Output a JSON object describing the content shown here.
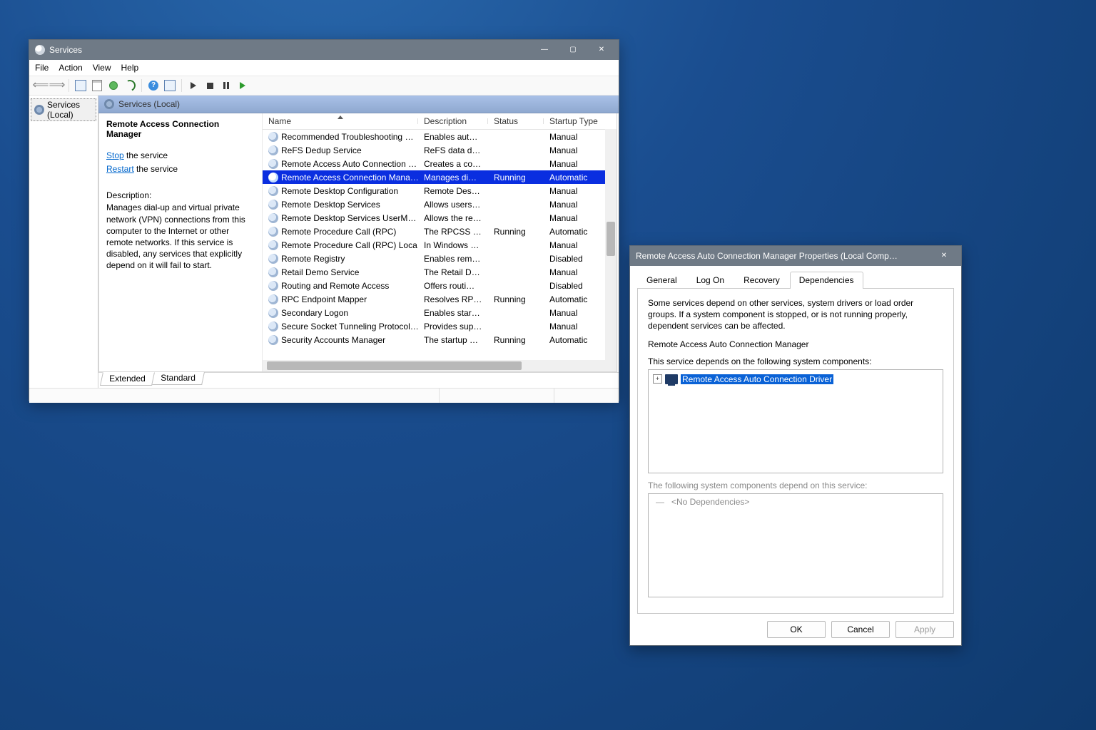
{
  "services_window": {
    "title": "Services",
    "menu": [
      "File",
      "Action",
      "View",
      "Help"
    ],
    "tree_root": "Services (Local)",
    "pane_title": "Services (Local)",
    "selected_name": "Remote Access Connection Manager",
    "action_stop": "Stop",
    "action_stop_suffix": " the service",
    "action_restart": "Restart",
    "action_restart_suffix": " the service",
    "desc_label": "Description:",
    "desc_text": "Manages dial-up and virtual private network (VPN) connections from this computer to the Internet or other remote networks. If this service is disabled, any services that explicitly depend on it will fail to start.",
    "columns": {
      "name": "Name",
      "desc": "Description",
      "status": "Status",
      "startup": "Startup Type"
    },
    "rows": [
      {
        "name": "Recommended Troubleshooting …",
        "desc": "Enables aut…",
        "status": "",
        "startup": "Manual"
      },
      {
        "name": "ReFS Dedup Service",
        "desc": "ReFS data d…",
        "status": "",
        "startup": "Manual"
      },
      {
        "name": "Remote Access Auto Connection …",
        "desc": "Creates a co…",
        "status": "",
        "startup": "Manual"
      },
      {
        "name": "Remote Access Connection Mana…",
        "desc": "Manages di…",
        "status": "Running",
        "startup": "Automatic",
        "selected": true
      },
      {
        "name": "Remote Desktop Configuration",
        "desc": "Remote Des…",
        "status": "",
        "startup": "Manual"
      },
      {
        "name": "Remote Desktop Services",
        "desc": "Allows users …",
        "status": "",
        "startup": "Manual"
      },
      {
        "name": "Remote Desktop Services UserM…",
        "desc": "Allows the re…",
        "status": "",
        "startup": "Manual"
      },
      {
        "name": "Remote Procedure Call (RPC)",
        "desc": "The RPCSS s…",
        "status": "Running",
        "startup": "Automatic"
      },
      {
        "name": "Remote Procedure Call (RPC) Loca…",
        "desc": "In Windows …",
        "status": "",
        "startup": "Manual"
      },
      {
        "name": "Remote Registry",
        "desc": "Enables rem…",
        "status": "",
        "startup": "Disabled"
      },
      {
        "name": "Retail Demo Service",
        "desc": "The Retail D…",
        "status": "",
        "startup": "Manual"
      },
      {
        "name": "Routing and Remote Access",
        "desc": "Offers routi…",
        "status": "",
        "startup": "Disabled"
      },
      {
        "name": "RPC Endpoint Mapper",
        "desc": "Resolves RP…",
        "status": "Running",
        "startup": "Automatic"
      },
      {
        "name": "Secondary Logon",
        "desc": "Enables start…",
        "status": "",
        "startup": "Manual"
      },
      {
        "name": "Secure Socket Tunneling Protocol…",
        "desc": "Provides sup…",
        "status": "",
        "startup": "Manual"
      },
      {
        "name": "Security Accounts Manager",
        "desc": "The startup …",
        "status": "Running",
        "startup": "Automatic"
      }
    ],
    "bottom_tabs": [
      "Extended",
      "Standard"
    ]
  },
  "props_dialog": {
    "title": "Remote Access Auto Connection Manager Properties (Local Comp…",
    "tabs": [
      "General",
      "Log On",
      "Recovery",
      "Dependencies"
    ],
    "active_tab": 3,
    "intro": "Some services depend on other services, system drivers or load order groups. If a system component is stopped, or is not running properly, dependent services can be affected.",
    "service_name": "Remote Access Auto Connection Manager",
    "depends_on_label": "This service depends on the following system components:",
    "depends_on_item": "Remote Access Auto Connection Driver",
    "dependents_label": "The following system components depend on this service:",
    "no_deps": "<No Dependencies>",
    "buttons": {
      "ok": "OK",
      "cancel": "Cancel",
      "apply": "Apply"
    }
  }
}
